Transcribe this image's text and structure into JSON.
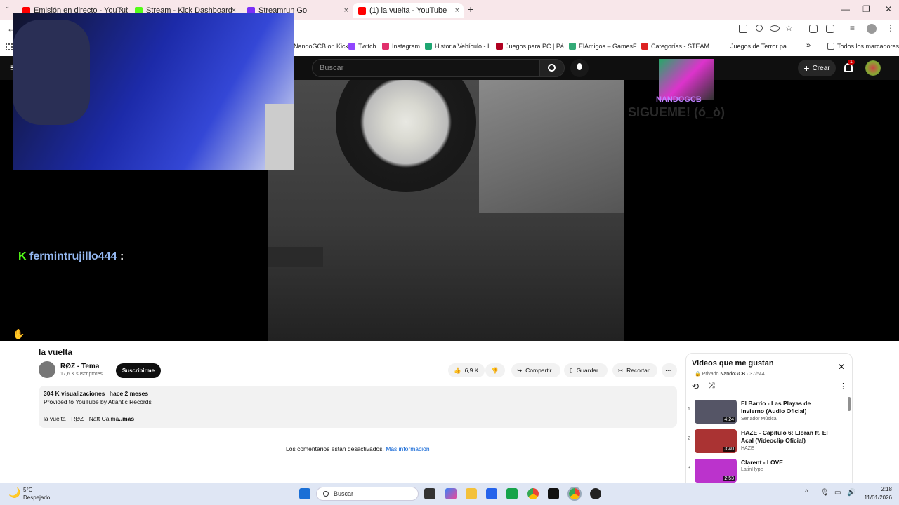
{
  "browser": {
    "tabs": [
      {
        "label": "Emisión en directo - YouTube S",
        "color": "#ff0000"
      },
      {
        "label": "Stream - Kick Dashboard",
        "color": "#53fc18"
      },
      {
        "label": "Streamrun Go",
        "color": "#7b2ff7"
      },
      {
        "label": "(1) la vuelta - YouTube",
        "color": "#ff0000"
      }
    ],
    "close_glyph": "×",
    "new_tab_glyph": "+",
    "window_controls": [
      "—",
      "❐",
      "✕"
    ],
    "bookmarks": [
      {
        "label": "NandoGCB on Kick",
        "color": "#53fc18"
      },
      {
        "label": "Twitch",
        "color": "#9146ff"
      },
      {
        "label": "Instagram",
        "color": "#e1306c"
      },
      {
        "label": "HistorialVehículo - I...",
        "color": "#1ea672"
      },
      {
        "label": "Juegos para PC | Pá...",
        "color": "#b00020"
      },
      {
        "label": "ElAmigos – GamesF...",
        "color": "#3a7"
      },
      {
        "label": "Categorías - STEAM...",
        "color": "#d22"
      },
      {
        "label": "Juegos de Terror pa...",
        "color": "#444"
      }
    ],
    "bookmarks_more": "»",
    "all_bookmarks": "Todos los marcadores"
  },
  "youtube_header": {
    "search_placeholder": "Buscar",
    "create_label": "Crear",
    "notification_count": "1"
  },
  "overlay": {
    "chat_user": "fermintrujillo444",
    "chat_sep": ":",
    "brand_tag": "NANDOGCB",
    "follow_text": "SIGUEME! (ó_ò)"
  },
  "video": {
    "title": "la vuelta",
    "channel": "RØZ - Tema",
    "subscribers": "17,6 K suscriptores",
    "subscribe_label": "Suscribirme",
    "likes": "6,9 K",
    "share_label": "Compartir",
    "save_label": "Guardar",
    "clip_label": "Recortar",
    "more_glyph": "⋯",
    "description": {
      "views": "304 K visualizaciones",
      "age": "hace 2 meses",
      "provided": "Provided to YouTube by Atlantic Records",
      "credits": "la vuelta · RØZ · Natt Calma",
      "more": "...más"
    },
    "comments_off": "Los comentarios están desactivados.",
    "more_info": "Más información"
  },
  "playlist": {
    "title": "Videos que me gustan",
    "privacy": "Privado",
    "owner": "NandoGCB",
    "position": "37/544",
    "close_glyph": "✕",
    "items": [
      {
        "num": "1",
        "title": "El Barrio - Las Playas de Invierno (Audio Oficial)",
        "channel": "Senador Música",
        "duration": "4:24",
        "color": "#556"
      },
      {
        "num": "2",
        "title": "HAZE - Capítulo 6: Lloran ft. El Acal (Videoclip Oficial)",
        "channel": "HAZE",
        "duration": "3:40",
        "color": "#a33"
      },
      {
        "num": "3",
        "title": "Clarent - LOVE",
        "channel": "LatinHype",
        "duration": "2:53",
        "color": "#b3c"
      }
    ]
  },
  "taskbar": {
    "weather_temp": "5°C",
    "weather_desc": "Despejado",
    "search_label": "Buscar",
    "time": "2:18",
    "date": "11/01/2026"
  }
}
